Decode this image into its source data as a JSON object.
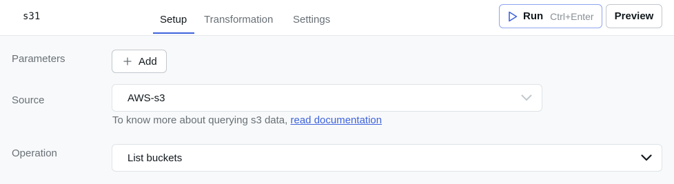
{
  "header": {
    "query_name": "s31",
    "tabs": [
      {
        "label": "Setup",
        "active": true
      },
      {
        "label": "Transformation",
        "active": false
      },
      {
        "label": "Settings",
        "active": false
      }
    ],
    "run_label": "Run",
    "run_shortcut": "Ctrl+Enter",
    "preview_label": "Preview"
  },
  "form": {
    "parameters_label": "Parameters",
    "add_label": "Add",
    "source_label": "Source",
    "source_value": "AWS-s3",
    "help_text": "To know more about querying s3 data, ",
    "help_link": "read documentation",
    "operation_label": "Operation",
    "operation_value": "List buckets"
  },
  "colors": {
    "accent": "#3e63dd",
    "muted_text": "#687076",
    "border": "#dfe3e6"
  },
  "icons": [
    "play-icon",
    "plus-icon",
    "chevron-down-icon"
  ]
}
